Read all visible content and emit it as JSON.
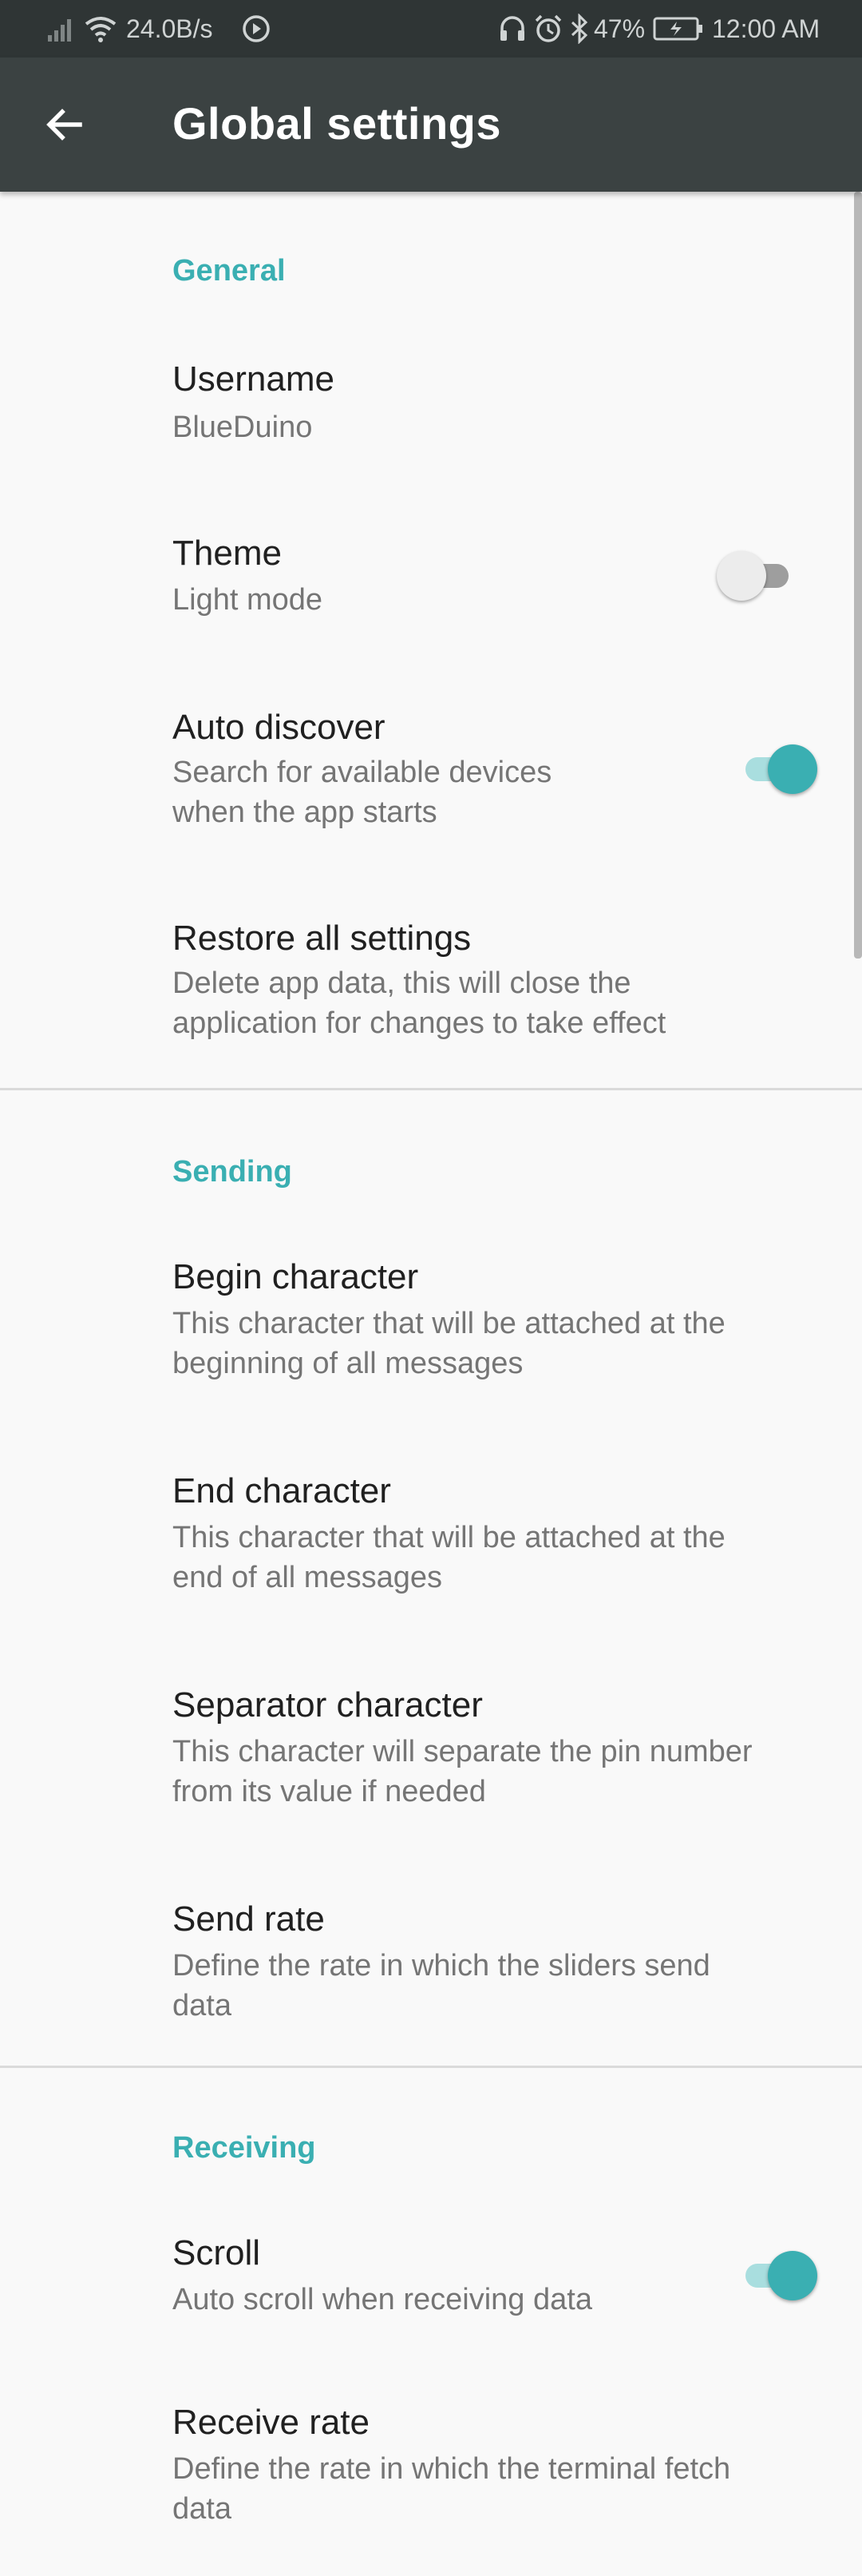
{
  "status_bar": {
    "net_speed": "24.0B/s",
    "battery_percent": "47%",
    "time": "12:00 AM",
    "icons": [
      "signal-icon",
      "wifi-icon",
      "sync-icon",
      "headphones-icon",
      "alarm-icon",
      "bluetooth-icon",
      "battery-charging-icon"
    ]
  },
  "app_bar": {
    "title": "Global settings",
    "back_icon": "arrow-back-icon",
    "background": "#3b4242"
  },
  "accent_color": "#3aafb2",
  "sections": {
    "general": {
      "header": "General",
      "username": {
        "title": "Username",
        "summary": "BlueDuino"
      },
      "theme": {
        "title": "Theme",
        "summary": "Light mode",
        "switch_on": false
      },
      "auto_discover": {
        "title": "Auto discover",
        "summary": "Search for available devices\nwhen the app starts",
        "switch_on": true
      },
      "restore": {
        "title": "Restore all settings",
        "summary": "Delete app data, this will close the\napplication for changes to take effect"
      }
    },
    "sending": {
      "header": "Sending",
      "begin_char": {
        "title": "Begin character",
        "summary": "This character that will be attached at the\nbeginning of all messages"
      },
      "end_char": {
        "title": "End character",
        "summary": "This character that will be attached at the\nend of all messages"
      },
      "separator_char": {
        "title": "Separator character",
        "summary": "This character will separate the pin number\nfrom its value if needed"
      },
      "send_rate": {
        "title": "Send rate",
        "summary": "Define the rate in which the sliders send\ndata"
      }
    },
    "receiving": {
      "header": "Receiving",
      "scroll": {
        "title": "Scroll",
        "summary": "Auto scroll when receiving data",
        "switch_on": true
      },
      "receive_rate": {
        "title": "Receive rate",
        "summary": "Define the rate in which the terminal fetch\ndata"
      }
    }
  }
}
